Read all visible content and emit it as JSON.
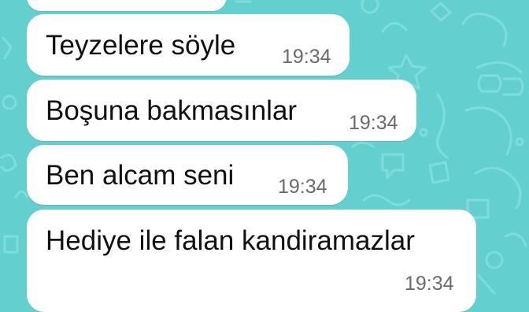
{
  "theme": {
    "wallpaper_color": "#63d0cf",
    "doodle_color": "#7fdcdb",
    "bubble_color": "#ffffff",
    "text_color": "#111111",
    "time_color": "#6b6b6b"
  },
  "chat": {
    "messages": [
      {
        "text": "",
        "time": ""
      },
      {
        "text": "Teyzelere söyle",
        "time": "19:34"
      },
      {
        "text": "Boşuna bakmasınlar",
        "time": "19:34"
      },
      {
        "text": "Ben alcam seni",
        "time": "19:34"
      },
      {
        "text": "Hediye ile falan kandiramazlar",
        "time": "19:34"
      }
    ]
  }
}
